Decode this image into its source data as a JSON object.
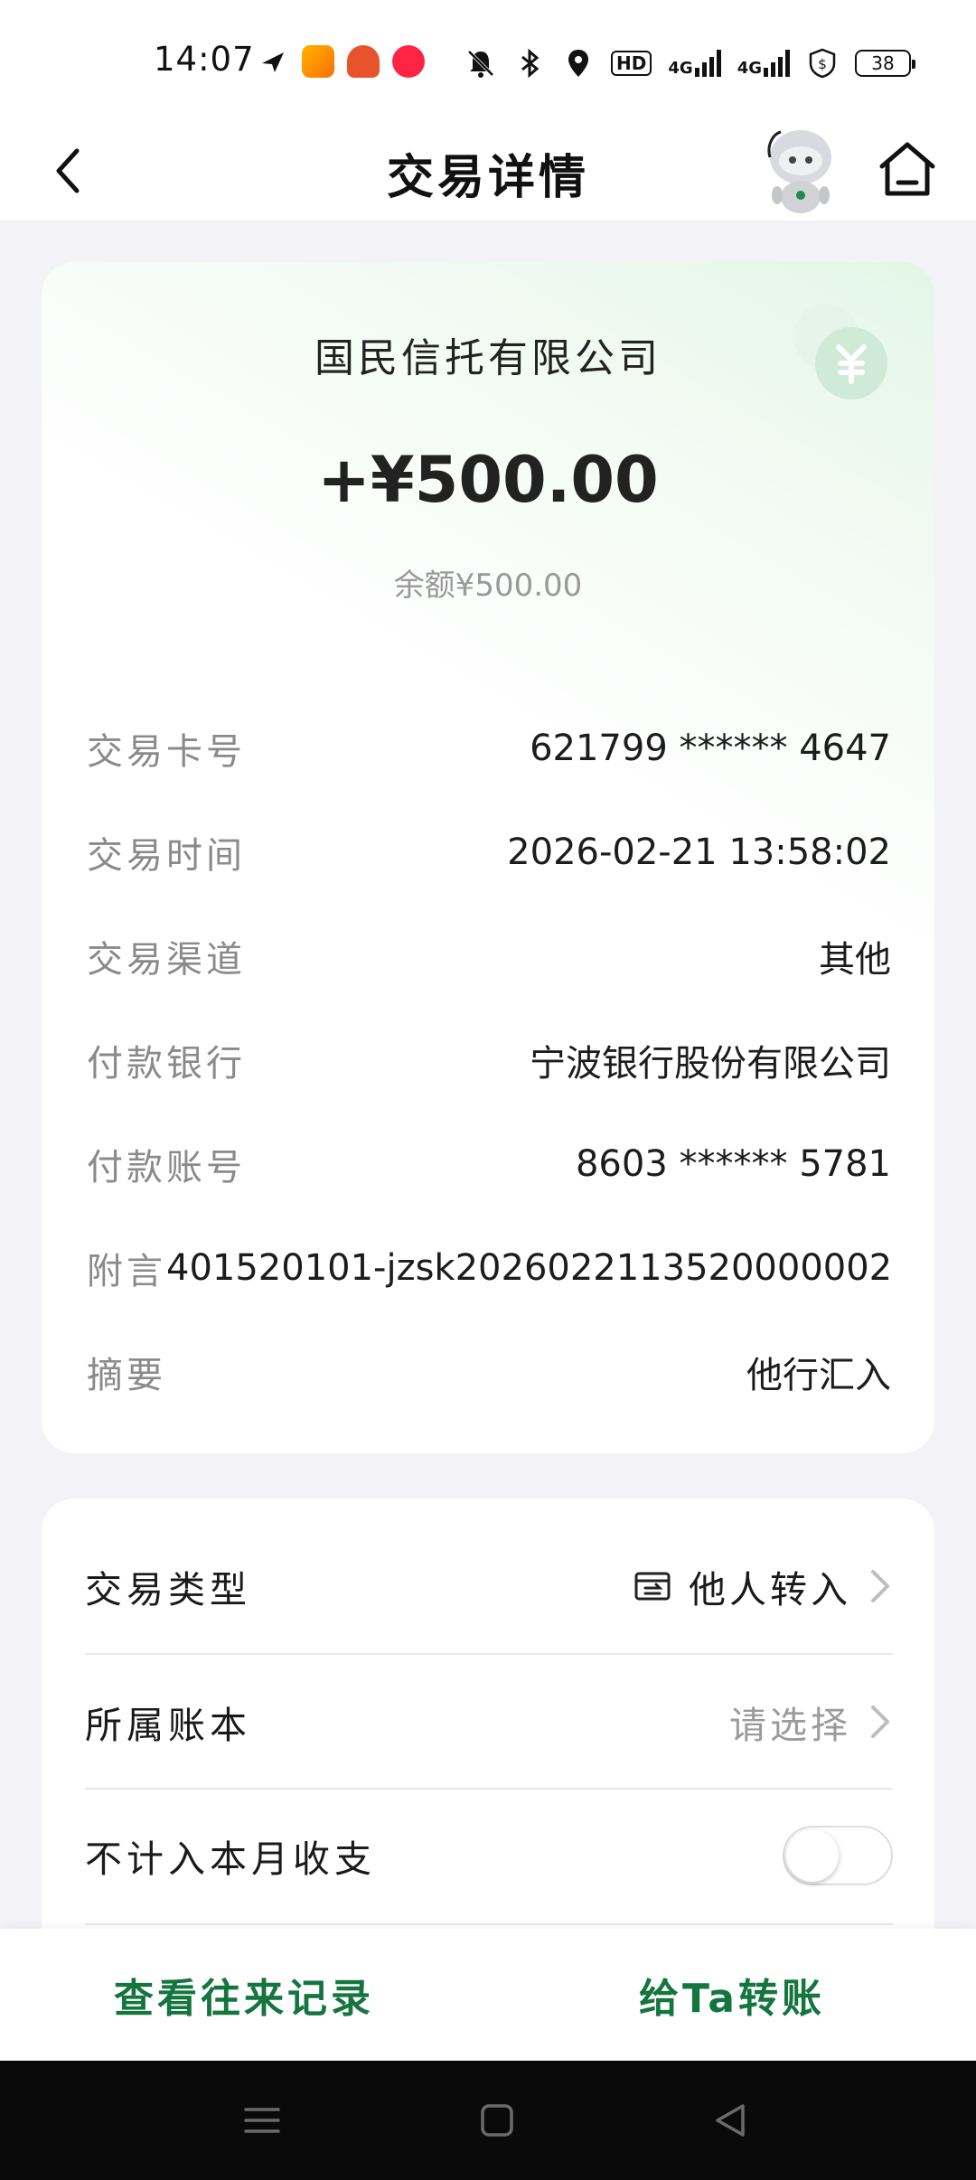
{
  "status_bar": {
    "time": "14:07",
    "hd_label": "HD",
    "net1": "4G",
    "net2": "4G",
    "battery": "38",
    "icons": [
      "send-icon",
      "video-app-icon",
      "shopping-app-icon",
      "red-app-icon",
      "mute-bell-icon",
      "bluetooth-icon",
      "location-icon",
      "hd-icon",
      "signal-icon",
      "signal-icon",
      "vpn-shield-icon",
      "battery-icon"
    ]
  },
  "header": {
    "title": "交易详情",
    "icons": [
      "back-icon",
      "robot-assistant-icon",
      "home-icon"
    ]
  },
  "transaction": {
    "payer": "国民信托有限公司",
    "amount": "+¥500.00",
    "balance": "余额¥500.00",
    "rows": [
      {
        "label": "交易卡号",
        "value": "621799 ****** 4647"
      },
      {
        "label": "交易时间",
        "value": "2026-02-21 13:58:02"
      },
      {
        "label": "交易渠道",
        "value": "其他"
      },
      {
        "label": "付款银行",
        "value": "宁波银行股份有限公司"
      },
      {
        "label": "付款账号",
        "value": "8603 ****** 5781"
      },
      {
        "label": "附言",
        "value": "401520101-jzsk2026022113520000002"
      },
      {
        "label": "摘要",
        "value": "他行汇入"
      }
    ]
  },
  "settings": {
    "type_label": "交易类型",
    "type_value": "他人转入",
    "ledger_label": "所属账本",
    "ledger_value": "请选择",
    "exclude_label": "不计入本月收支",
    "exclude_enabled": false
  },
  "actions": {
    "history": "查看往来记录",
    "transfer": "给Ta转账"
  },
  "colors": {
    "accent": "#14753f",
    "background": "#f2f2f7",
    "coin": "#cfead6"
  }
}
